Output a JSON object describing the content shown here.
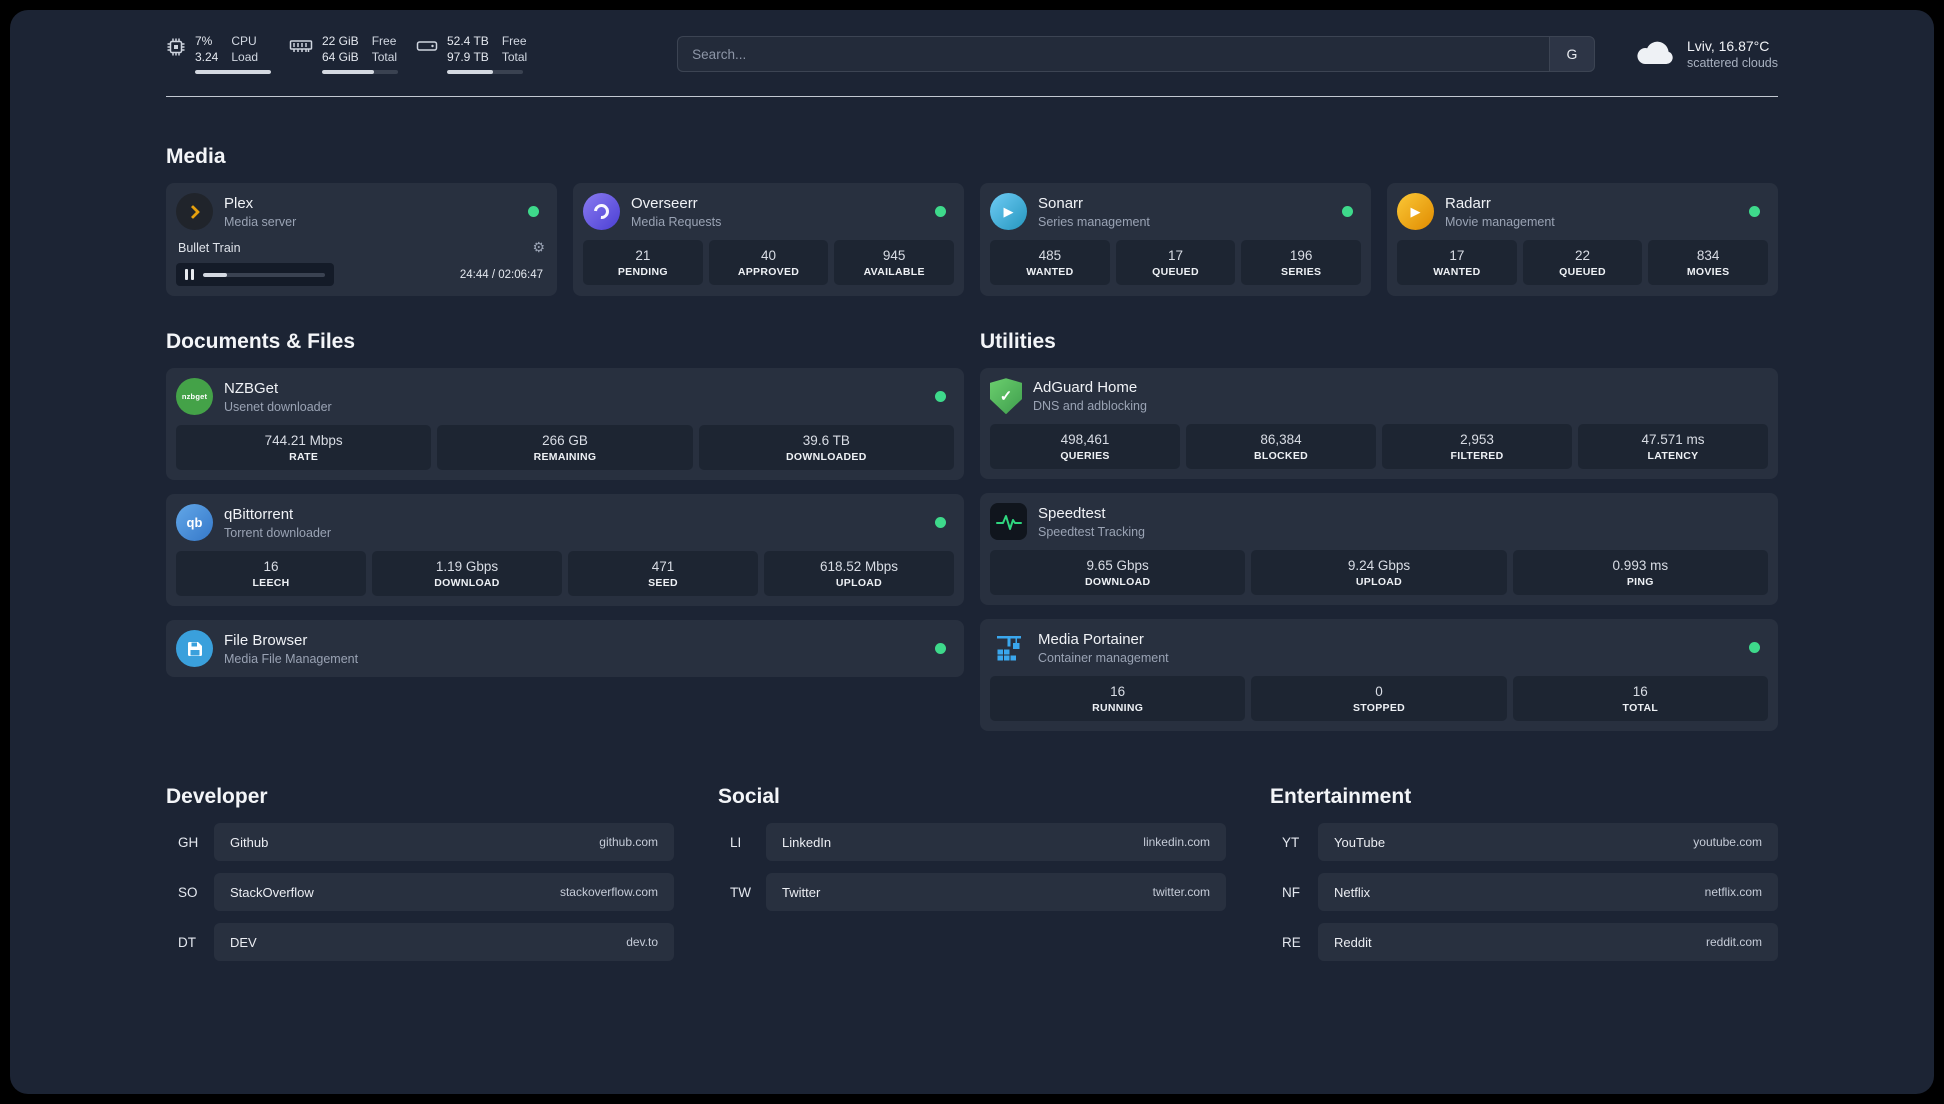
{
  "colors": {
    "background": "#1c2434",
    "card": "#28303f",
    "stat_box": "#1d2532",
    "online_dot": "#3ed98b"
  },
  "topbar": {
    "cpu": {
      "value_top": "7%",
      "value_bottom": "3.24",
      "label_top": "CPU",
      "label_bottom": "Load",
      "percent": 100
    },
    "memory": {
      "value_top": "22 GiB",
      "value_bottom": "64 GiB",
      "label_top": "Free",
      "label_bottom": "Total",
      "percent": 68
    },
    "disk": {
      "value_top": "52.4 TB",
      "value_bottom": "97.9 TB",
      "label_top": "Free",
      "label_bottom": "Total",
      "percent": 60
    },
    "search": {
      "placeholder": "Search...",
      "provider_label": "G"
    },
    "weather": {
      "location": "Lviv, 16.87°C",
      "condition": "scattered clouds"
    }
  },
  "icons": {
    "gear": "⚙",
    "check": "✓",
    "play": "▶",
    "nzbget_label": "nzbget",
    "qbittorrent_label": "qb"
  },
  "media": {
    "title": "Media",
    "plex": {
      "name": "Plex",
      "subtitle": "Media server",
      "now_playing": "Bullet Train",
      "time": "24:44 / 02:06:47",
      "progress_percent": 20
    },
    "overseerr": {
      "name": "Overseerr",
      "subtitle": "Media Requests",
      "stats": [
        {
          "value": "21",
          "label": "PENDING"
        },
        {
          "value": "40",
          "label": "APPROVED"
        },
        {
          "value": "945",
          "label": "AVAILABLE"
        }
      ]
    },
    "sonarr": {
      "name": "Sonarr",
      "subtitle": "Series management",
      "stats": [
        {
          "value": "485",
          "label": "WANTED"
        },
        {
          "value": "17",
          "label": "QUEUED"
        },
        {
          "value": "196",
          "label": "SERIES"
        }
      ]
    },
    "radarr": {
      "name": "Radarr",
      "subtitle": "Movie management",
      "stats": [
        {
          "value": "17",
          "label": "WANTED"
        },
        {
          "value": "22",
          "label": "QUEUED"
        },
        {
          "value": "834",
          "label": "MOVIES"
        }
      ]
    }
  },
  "documents": {
    "title": "Documents & Files",
    "nzbget": {
      "name": "NZBGet",
      "subtitle": "Usenet downloader",
      "stats": [
        {
          "value": "744.21 Mbps",
          "label": "RATE"
        },
        {
          "value": "266 GB",
          "label": "REMAINING"
        },
        {
          "value": "39.6 TB",
          "label": "DOWNLOADED"
        }
      ]
    },
    "qbittorrent": {
      "name": "qBittorrent",
      "subtitle": "Torrent downloader",
      "stats": [
        {
          "value": "16",
          "label": "LEECH"
        },
        {
          "value": "1.19 Gbps",
          "label": "DOWNLOAD"
        },
        {
          "value": "471",
          "label": "SEED"
        },
        {
          "value": "618.52 Mbps",
          "label": "UPLOAD"
        }
      ]
    },
    "filebrowser": {
      "name": "File Browser",
      "subtitle": "Media File Management"
    }
  },
  "utilities": {
    "title": "Utilities",
    "adguard": {
      "name": "AdGuard Home",
      "subtitle": "DNS and adblocking",
      "stats": [
        {
          "value": "498,461",
          "label": "QUERIES"
        },
        {
          "value": "86,384",
          "label": "BLOCKED"
        },
        {
          "value": "2,953",
          "label": "FILTERED"
        },
        {
          "value": "47.571 ms",
          "label": "LATENCY"
        }
      ]
    },
    "speedtest": {
      "name": "Speedtest",
      "subtitle": "Speedtest Tracking",
      "stats": [
        {
          "value": "9.65 Gbps",
          "label": "DOWNLOAD"
        },
        {
          "value": "9.24 Gbps",
          "label": "UPLOAD"
        },
        {
          "value": "0.993 ms",
          "label": "PING"
        }
      ]
    },
    "portainer": {
      "name": "Media Portainer",
      "subtitle": "Container management",
      "stats": [
        {
          "value": "16",
          "label": "RUNNING"
        },
        {
          "value": "0",
          "label": "STOPPED"
        },
        {
          "value": "16",
          "label": "TOTAL"
        }
      ]
    }
  },
  "bookmarks": {
    "developer": {
      "title": "Developer",
      "items": [
        {
          "abbr": "GH",
          "name": "Github",
          "url": "github.com"
        },
        {
          "abbr": "SO",
          "name": "StackOverflow",
          "url": "stackoverflow.com"
        },
        {
          "abbr": "DT",
          "name": "DEV",
          "url": "dev.to"
        }
      ]
    },
    "social": {
      "title": "Social",
      "items": [
        {
          "abbr": "LI",
          "name": "LinkedIn",
          "url": "linkedin.com"
        },
        {
          "abbr": "TW",
          "name": "Twitter",
          "url": "twitter.com"
        }
      ]
    },
    "entertainment": {
      "title": "Entertainment",
      "items": [
        {
          "abbr": "YT",
          "name": "YouTube",
          "url": "youtube.com"
        },
        {
          "abbr": "NF",
          "name": "Netflix",
          "url": "netflix.com"
        },
        {
          "abbr": "RE",
          "name": "Reddit",
          "url": "reddit.com"
        }
      ]
    }
  }
}
